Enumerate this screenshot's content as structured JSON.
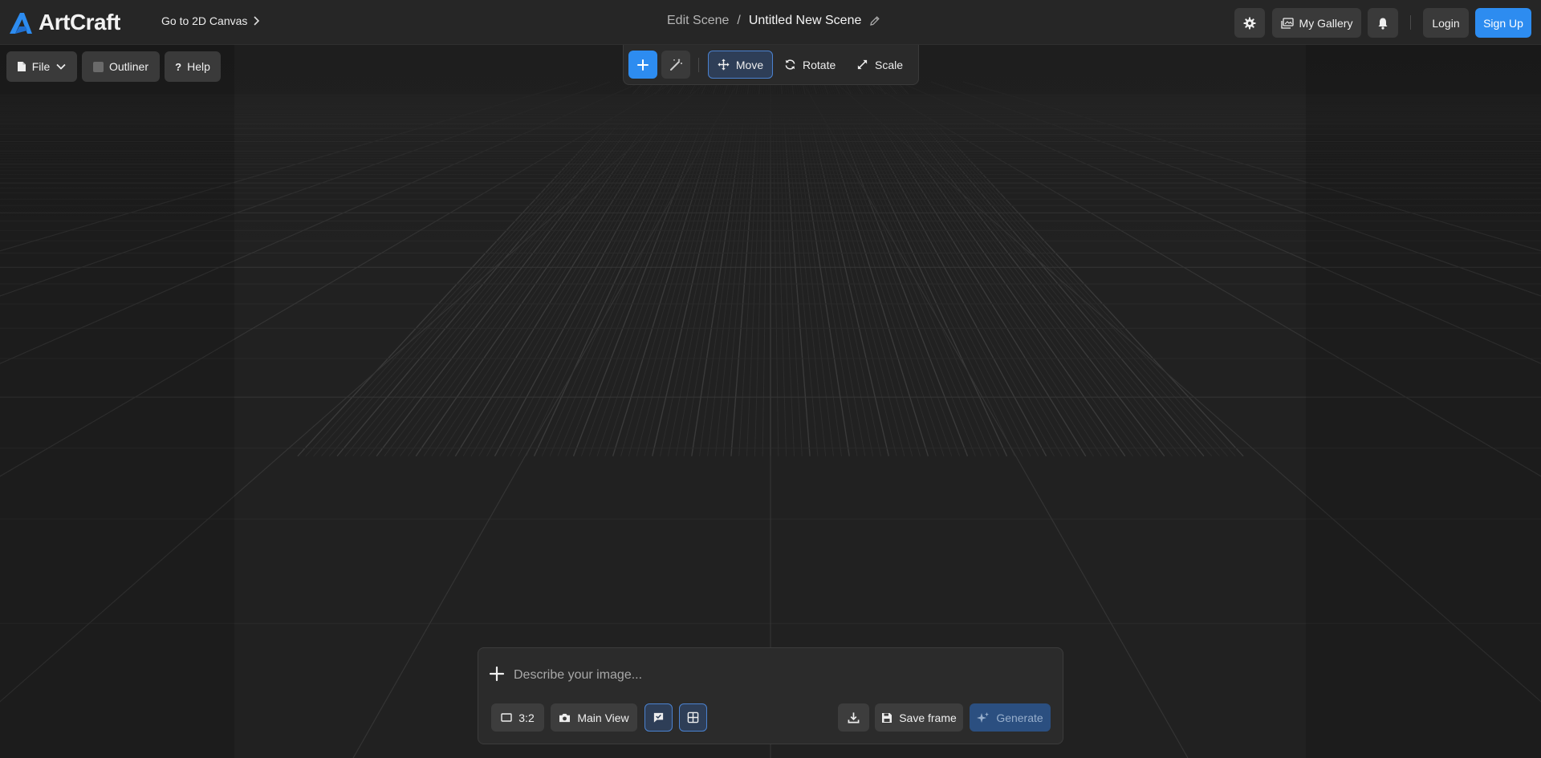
{
  "colors": {
    "accent": "#2d8cf0",
    "background": "#212121",
    "topbar": "#262626",
    "panel": "#2b2b2b",
    "button": "#3a3a3a"
  },
  "header": {
    "brand": "ArtCraft",
    "goto_label": "Go to 2D Canvas",
    "breadcrumb_parent": "Edit Scene",
    "breadcrumb_separator": "/",
    "scene_title": "Untitled New Scene",
    "gallery_label": "My Gallery",
    "login_label": "Login",
    "signup_label": "Sign Up"
  },
  "menu": {
    "file_label": "File",
    "outliner_label": "Outliner",
    "help_label": "Help"
  },
  "toolbar": {
    "move_label": "Move",
    "rotate_label": "Rotate",
    "scale_label": "Scale",
    "active_tool": "Move"
  },
  "prompt": {
    "placeholder": "Describe your image...",
    "aspect_label": "3:2",
    "camera_label": "Main View",
    "save_label": "Save frame",
    "generate_label": "Generate"
  }
}
